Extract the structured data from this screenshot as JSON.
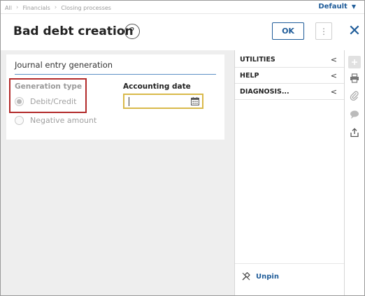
{
  "breadcrumb": [
    "All",
    "Financials",
    "Closing processes"
  ],
  "default_selector": {
    "label": "Default"
  },
  "header": {
    "title": "Bad debt creation",
    "help_symbol": "?",
    "ok_label": "OK",
    "more_symbol": "⋮",
    "close_symbol": "✕"
  },
  "section": {
    "title": "Journal entry generation",
    "generation_type": {
      "label": "Generation type",
      "options": [
        "Debit/Credit",
        "Negative amount"
      ],
      "selected": "Debit/Credit"
    },
    "accounting_date": {
      "label": "Accounting date",
      "value": ""
    }
  },
  "side_panel": {
    "items": [
      {
        "label": "UTILITIES",
        "chevron": "<"
      },
      {
        "label": "HELP",
        "chevron": "<"
      },
      {
        "label": "DIAGNOSIS...",
        "chevron": "<"
      }
    ],
    "unpin_label": "Unpin"
  },
  "icons": {
    "help": "help-circle-icon",
    "calendar": "calendar-icon",
    "unpin": "unpin-icon",
    "rail": [
      "plus-icon",
      "printer-icon",
      "paperclip-icon",
      "comment-icon",
      "share-icon"
    ]
  },
  "colors": {
    "accent": "#1f5c99",
    "highlight_box": "#b22a2a",
    "focus_border": "#d9b94a",
    "panel_bg": "#eeeeee"
  }
}
